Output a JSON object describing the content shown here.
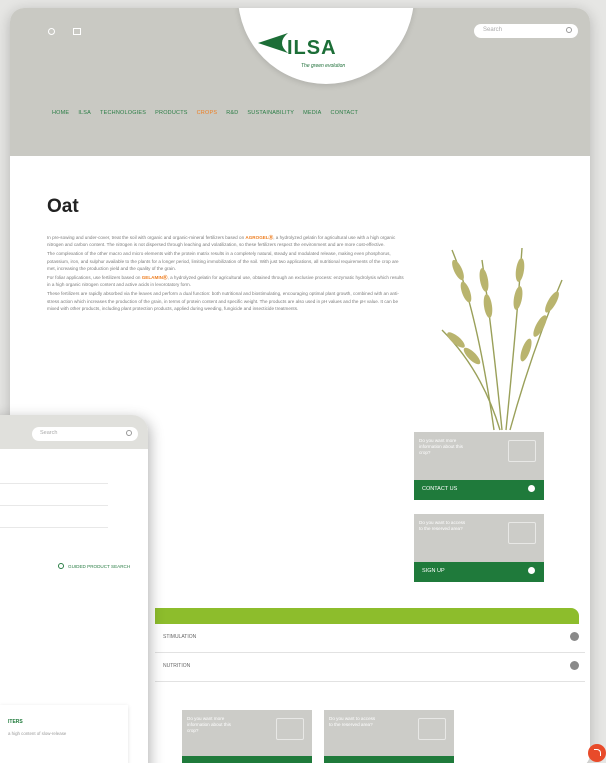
{
  "header": {
    "util_left": "",
    "util_right": "",
    "logo": "ILSA",
    "tagline": "The green evolution",
    "search_placeholder": "Search"
  },
  "nav": [
    "HOME",
    "ILSA",
    "TECHNOLOGIES",
    "PRODUCTS",
    "CROPS",
    "R&D",
    "SUSTAINABILITY",
    "MEDIA",
    "CONTACT"
  ],
  "breadcrumb": "",
  "title": "Oat",
  "body": {
    "p1": "In pre-sowing and under-cover, treat the soil with organic and organic-mineral fertilizers based on",
    "p1_hl": "AGROGELⓇ",
    "p1_rest": ", a hydrolyzed gelatin for agricultural use with a high organic nitrogen and carbon content. The nitrogen is not dispersed through leaching and volatilization, so these fertilizers respect the environment and are more cost-effective.",
    "p2": "The complexation of the other macro and micro elements with the protein matrix results in a completely natural, steady and modulated release, making even phosphorus, potassium, iron, and sulphur available to the plants for a longer period, limiting immobilization of the soil. With just two applications, all nutritional requirements of the crop are met, increasing the production yield and the quality of the grain.",
    "p3": "For foliar applications, use fertilizers based on",
    "p3_hl": "GELAMINⓇ",
    "p3_rest": ", a hydrolyzed gelatin for agricultural use, obtained through an exclusive process: enzymatic hydrolysis which results in a high organic nitrogen content and active acids in levorotatory form.",
    "p4": "These fertilizers are rapidly absorbed via the leaves and perform a dual function: both nutritional and biostimulating, encouraging optimal plant growth, combined with an anti-stress action which increases the production of the grain, in terms of protein content and specific weight. The products are also used in pH values and the pH value. It can be mixed with other products, including plant protection products, applied during weeding, fungicide and insecticide treatments."
  },
  "side_cards": [
    {
      "question": "Do you want more information about this crop?",
      "action": "CONTACT US"
    },
    {
      "question": "Do you want to access to the reserved area?",
      "action": "SIGN UP"
    }
  ],
  "accordion": [
    "STIMULATION",
    "NUTRITION"
  ],
  "bottom_cards": [
    {
      "question": "Do you want more information about this crop?"
    },
    {
      "question": "Do you want to access to the reserved area?"
    }
  ],
  "phone": {
    "search_placeholder": "Search",
    "guided": "GUIDED PRODUCT SEARCH",
    "card_title": "ITERS",
    "card_desc": "a high content of slow-release"
  },
  "colors": {
    "green": "#1f7a3b",
    "lime": "#8dbd2c",
    "orange": "#ee7f22",
    "grey": "#c9c9c3"
  }
}
